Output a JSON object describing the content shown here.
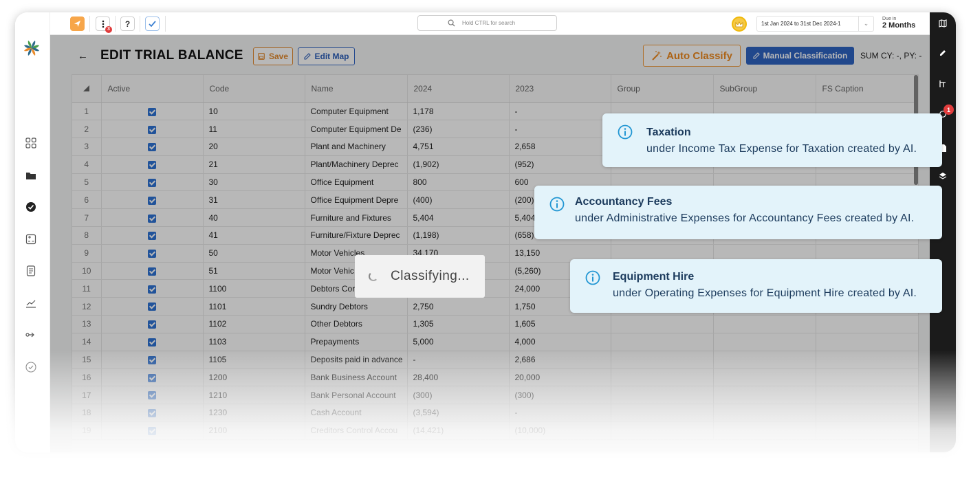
{
  "topbar": {
    "search_placeholder": "Hold CTRL for search",
    "notification_count": "3",
    "help_label": "?",
    "date_range": "1st Jan 2024 to 31st Dec 2024-1",
    "due_label": "Due in",
    "due_value": "2 Months"
  },
  "header": {
    "title": "EDIT TRIAL BALANCE",
    "save_label": "Save",
    "edit_map_label": "Edit Map",
    "auto_classify_label": "Auto Classify",
    "manual_classification_label": "Manual Classification",
    "sum_text": "SUM CY: -, PY: -"
  },
  "rightbar": {
    "badge": "1"
  },
  "table": {
    "columns": [
      "Active",
      "Code",
      "Name",
      "2024",
      "2023",
      "Group",
      "SubGroup",
      "FS Caption"
    ],
    "rows": [
      {
        "n": "1",
        "code": "10",
        "name": "Computer Equipment",
        "cy": "1,178",
        "py": "-"
      },
      {
        "n": "2",
        "code": "11",
        "name": "Computer Equipment De",
        "cy": "(236)",
        "py": "-"
      },
      {
        "n": "3",
        "code": "20",
        "name": "Plant and Machinery",
        "cy": "4,751",
        "py": "2,658"
      },
      {
        "n": "4",
        "code": "21",
        "name": "Plant/Machinery Deprec",
        "cy": "(1,902)",
        "py": "(952)"
      },
      {
        "n": "5",
        "code": "30",
        "name": "Office Equipment",
        "cy": "800",
        "py": "600"
      },
      {
        "n": "6",
        "code": "31",
        "name": "Office Equipment Depre",
        "cy": "(400)",
        "py": "(200)"
      },
      {
        "n": "7",
        "code": "40",
        "name": "Furniture and Fixtures",
        "cy": "5,404",
        "py": "5,404"
      },
      {
        "n": "8",
        "code": "41",
        "name": "Furniture/Fixture Deprec",
        "cy": "(1,198)",
        "py": "(658)"
      },
      {
        "n": "9",
        "code": "50",
        "name": "Motor Vehicles",
        "cy": "34,170",
        "py": "13,150"
      },
      {
        "n": "10",
        "code": "51",
        "name": "Motor Vehic",
        "cy": "",
        "py": "(5,260)"
      },
      {
        "n": "11",
        "code": "1100",
        "name": "Debtors Cor",
        "cy": "",
        "py": "24,000"
      },
      {
        "n": "12",
        "code": "1101",
        "name": "Sundry Debtors",
        "cy": "2,750",
        "py": "1,750"
      },
      {
        "n": "13",
        "code": "1102",
        "name": "Other Debtors",
        "cy": "1,305",
        "py": "1,605"
      },
      {
        "n": "14",
        "code": "1103",
        "name": "Prepayments",
        "cy": "5,000",
        "py": "4,000"
      },
      {
        "n": "15",
        "code": "1105",
        "name": "Deposits paid in advance",
        "cy": "-",
        "py": "2,686"
      },
      {
        "n": "16",
        "code": "1200",
        "name": "Bank Business Account",
        "cy": "28,400",
        "py": "20,000"
      },
      {
        "n": "17",
        "code": "1210",
        "name": "Bank Personal Account",
        "cy": "(300)",
        "py": "(300)"
      },
      {
        "n": "18",
        "code": "1230",
        "name": "Cash Account",
        "cy": "(3,594)",
        "py": "-"
      },
      {
        "n": "19",
        "code": "2100",
        "name": "Creditors Control Accou",
        "cy": "(14,421)",
        "py": "(10,000)"
      }
    ]
  },
  "loader": {
    "text": "Classifying..."
  },
  "toasts": [
    {
      "title": "Taxation",
      "body": "under Income Tax Expense for Taxation created by AI."
    },
    {
      "title": "Accountancy Fees",
      "body": "under Administrative Expenses for Accountancy Fees created by AI."
    },
    {
      "title": "Equipment Hire",
      "body": "under Operating Expenses for Equipment Hire created by AI."
    }
  ],
  "colors": {
    "accent_orange": "#ef8a1f",
    "accent_blue": "#2f64c2",
    "toast_bg": "#e3f3fa",
    "toast_text": "#1b3a5c",
    "info_icon": "#2196d3"
  }
}
